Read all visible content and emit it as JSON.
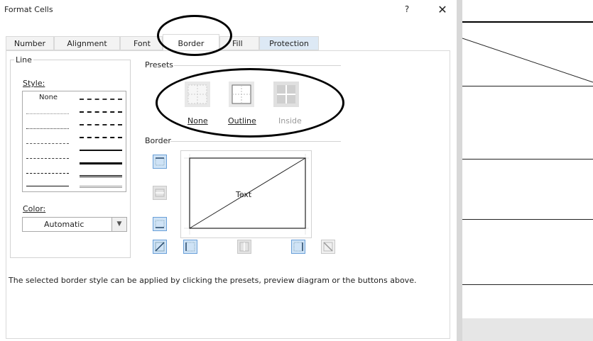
{
  "dialog": {
    "title": "Format Cells",
    "help_label": "?",
    "close_label": "✕"
  },
  "tabs": [
    {
      "label": "Number"
    },
    {
      "label": "Alignment"
    },
    {
      "label": "Font"
    },
    {
      "label": "Border",
      "active": true
    },
    {
      "label": "Fill"
    },
    {
      "label": "Protection"
    }
  ],
  "line": {
    "group_label": "Line",
    "style_label": "Style:",
    "none_label": "None",
    "color_label": "Color:",
    "color_value": "Automatic",
    "dropdown_icon": "chevron-down-icon"
  },
  "presets": {
    "group_label": "Presets",
    "items": [
      {
        "label": "None",
        "enabled": true
      },
      {
        "label": "Outline",
        "enabled": true
      },
      {
        "label": "Inside",
        "enabled": false
      }
    ]
  },
  "border": {
    "group_label": "Border",
    "preview_text": "Text"
  },
  "help_text": "The selected border style can be applied by clicking the presets, preview diagram or the buttons above.",
  "colors": {
    "accent_blue": "#cfe3f6",
    "annotation": "#000000"
  }
}
